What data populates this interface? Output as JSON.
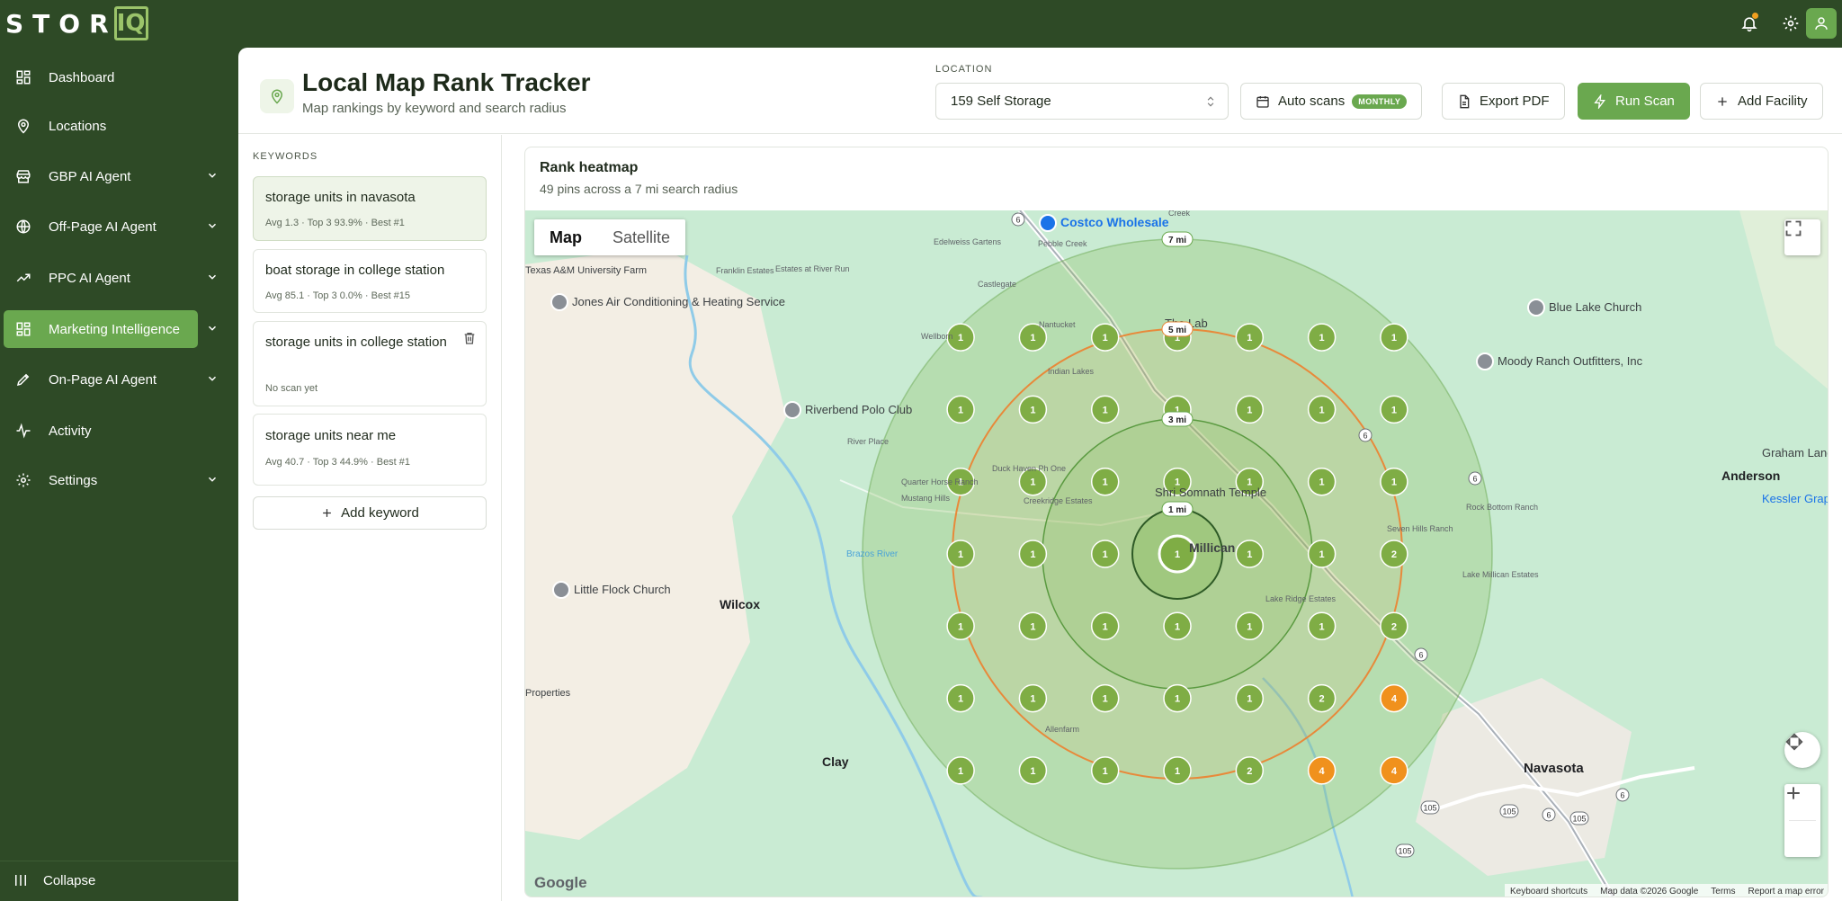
{
  "app": {
    "logo_text": "STOR",
    "logo_box": "IQ"
  },
  "colors": {
    "sidebar_bg": "#2e4a26",
    "accent": "#6aa84f",
    "rank_top3": "#7fad45",
    "rank_low": "#f0911d"
  },
  "topbar": {
    "icons": [
      "bell-icon",
      "gear-icon",
      "user-icon"
    ]
  },
  "sidebar": {
    "items": [
      {
        "label": "Dashboard",
        "icon": "grid-icon",
        "expandable": false
      },
      {
        "label": "Locations",
        "icon": "map-pin-icon",
        "expandable": false
      },
      {
        "label": "GBP AI Agent",
        "icon": "store-icon",
        "expandable": true
      },
      {
        "label": "Off-Page AI Agent",
        "icon": "globe-icon",
        "expandable": true
      },
      {
        "label": "PPC AI Agent",
        "icon": "trend-up-icon",
        "expandable": true
      },
      {
        "label": "Marketing Intelligence",
        "icon": "grid-icon",
        "expandable": true,
        "active": true
      },
      {
        "label": "On-Page AI Agent",
        "icon": "pen-icon",
        "expandable": true
      },
      {
        "label": "Activity",
        "icon": "activity-icon",
        "expandable": false
      },
      {
        "label": "Settings",
        "icon": "gear-icon",
        "expandable": true
      }
    ],
    "collapse_label": "Collapse"
  },
  "header": {
    "title": "Local Map Rank Tracker",
    "subtitle": "Map rankings by keyword and search radius",
    "location_label": "LOCATION",
    "location_value": "159 Self Storage",
    "auto_scans_label": "Auto scans",
    "auto_scans_badge": "MONTHLY",
    "export_label": "Export PDF",
    "run_scan_label": "Run Scan",
    "add_facility_label": "Add Facility"
  },
  "keywords": {
    "heading": "KEYWORDS",
    "items": [
      {
        "title": "storage units in navasota",
        "meta": "Avg 1.3 · Top 3 93.9% · Best #1",
        "selected": true
      },
      {
        "title": "boat storage in college station",
        "meta": "Avg 85.1 · Top 3 0.0% · Best #15",
        "selected": false
      },
      {
        "title": "storage units in college station",
        "meta": "No scan yet",
        "selected": false
      },
      {
        "title": "storage units near me",
        "meta": "Avg 40.7 · Top 3 44.9% · Best #1",
        "selected": false
      }
    ],
    "add_label": "Add keyword"
  },
  "heatmap": {
    "title": "Rank heatmap",
    "subtitle": "49 pins across a 7 mi search radius",
    "map_tab": "Map",
    "satellite_tab": "Satellite",
    "radius_labels": [
      "1 mi",
      "3 mi",
      "5 mi",
      "7 mi"
    ],
    "grid_ranks": [
      [
        1,
        1,
        1,
        1,
        1,
        1,
        1
      ],
      [
        1,
        1,
        1,
        1,
        1,
        1,
        1
      ],
      [
        1,
        1,
        1,
        1,
        1,
        1,
        1
      ],
      [
        1,
        1,
        1,
        1,
        1,
        1,
        2
      ],
      [
        1,
        1,
        1,
        1,
        1,
        1,
        2
      ],
      [
        1,
        1,
        1,
        1,
        1,
        2,
        4
      ],
      [
        1,
        1,
        1,
        1,
        2,
        4,
        4
      ]
    ],
    "places": [
      {
        "name": "Costco Wholesale",
        "color": "#1a73e8"
      },
      {
        "name": "Jones Air Conditioning & Heating Service",
        "color": "#3c4043"
      },
      {
        "name": "Riverbend Polo Club",
        "color": "#3c4043"
      },
      {
        "name": "Little Flock Church",
        "color": "#3c4043"
      },
      {
        "name": "Blue Lake Church",
        "color": "#3c4043"
      },
      {
        "name": "Moody Ranch Outfitters, Inc",
        "color": "#3c4043"
      },
      {
        "name": "The Lab",
        "color": "#3c4043"
      },
      {
        "name": "Millican",
        "color": "#3c4043"
      },
      {
        "name": "Wilcox",
        "color": "#202124"
      },
      {
        "name": "Clay",
        "color": "#202124"
      },
      {
        "name": "Navasota",
        "color": "#202124"
      },
      {
        "name": "Anderson",
        "color": "#202124"
      },
      {
        "name": "Kessler Grap",
        "color": "#1a73e8"
      },
      {
        "name": "Graham Land Se",
        "color": "#3c4043"
      },
      {
        "name": "Shri Somnath Temple",
        "color": "#3c4043"
      },
      {
        "name": "Edelweiss Gartens",
        "color": "#5f6368"
      },
      {
        "name": "Pebble Creek",
        "color": "#5f6368"
      },
      {
        "name": "Franklin Estates",
        "color": "#5f6368"
      },
      {
        "name": "Estates at River Run",
        "color": "#5f6368"
      },
      {
        "name": "Castlegate",
        "color": "#5f6368"
      },
      {
        "name": "Nantucket",
        "color": "#5f6368"
      },
      {
        "name": "Indian Lakes",
        "color": "#5f6368"
      },
      {
        "name": "River Place",
        "color": "#5f6368"
      },
      {
        "name": "Duck Haven Ph One",
        "color": "#5f6368"
      },
      {
        "name": "Quarter Horse Ranch",
        "color": "#5f6368"
      },
      {
        "name": "Mustang Hills",
        "color": "#5f6368"
      },
      {
        "name": "Creekridge Estates",
        "color": "#5f6368"
      },
      {
        "name": "Rock Bottom Ranch",
        "color": "#5f6368"
      },
      {
        "name": "Seven Hills Ranch",
        "color": "#5f6368"
      },
      {
        "name": "Lake Millican Estates",
        "color": "#5f6368"
      },
      {
        "name": "Lake Ridge Estates",
        "color": "#5f6368"
      },
      {
        "name": "Allenfarm",
        "color": "#5f6368"
      },
      {
        "name": "Brazos River",
        "color": "#4aa3d8"
      },
      {
        "name": "Texas A&M University Farm",
        "color": "#3c4043"
      },
      {
        "name": "Properties",
        "color": "#3c4043"
      },
      {
        "name": "Wellborn",
        "color": "#5f6368"
      },
      {
        "name": "Creek",
        "color": "#5f6368"
      }
    ],
    "road_shields": [
      "6",
      "105"
    ],
    "google_label": "Google",
    "footer": [
      "Keyboard shortcuts",
      "Map data ©2026 Google",
      "Terms",
      "Report a map error"
    ]
  }
}
